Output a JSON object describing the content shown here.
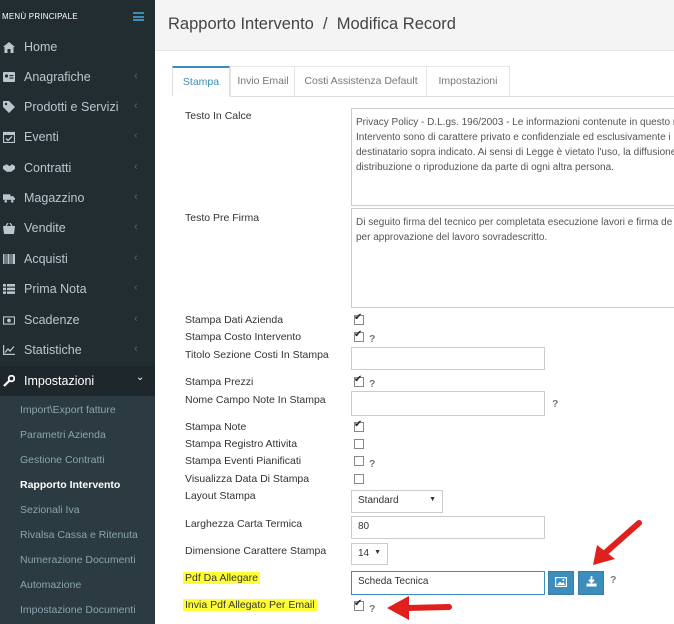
{
  "sidebar": {
    "header": "MENÙ PRINCIPALE",
    "items": [
      {
        "label": "Home",
        "icon": "home-icon"
      },
      {
        "label": "Anagrafiche",
        "icon": "id-card-icon"
      },
      {
        "label": "Prodotti e Servizi",
        "icon": "tag-icon"
      },
      {
        "label": "Eventi",
        "icon": "calendar-check-icon"
      },
      {
        "label": "Contratti",
        "icon": "handshake-icon"
      },
      {
        "label": "Magazzino",
        "icon": "truck-icon"
      },
      {
        "label": "Vendite",
        "icon": "basket-icon"
      },
      {
        "label": "Acquisti",
        "icon": "barcode-icon"
      },
      {
        "label": "Prima Nota",
        "icon": "list-icon"
      },
      {
        "label": "Scadenze",
        "icon": "money-icon"
      },
      {
        "label": "Statistiche",
        "icon": "chart-icon"
      },
      {
        "label": "Impostazioni",
        "icon": "wrench-icon"
      }
    ],
    "submenu": [
      "Import\\Export fatture",
      "Parametri Azienda",
      "Gestione Contratti",
      "Rapporto Intervento",
      "Sezionali Iva",
      "Rivalsa Cassa e Ritenuta",
      "Numerazione Documenti",
      "Automazione",
      "Impostazione Documenti"
    ]
  },
  "page": {
    "title": "Rapporto Intervento  /  Modifica Record"
  },
  "tabs": [
    "Stampa",
    "Invio Email",
    "Costi Assistenza Default",
    "Impostazioni"
  ],
  "form": {
    "testo_in_calce": {
      "label": "Testo In Calce",
      "lines": [
        "Privacy Policy - D.L.gs. 196/2003 - Le informazioni contenute in questo r",
        "Intervento sono di carattere privato e confidenziale ed esclusivamente i",
        "destinatario sopra indicato. Ai sensi di Legge è vietato l'uso, la diffusione",
        "distribuzione o riproduzione da parte di ogni altra persona."
      ]
    },
    "testo_pre_firma": {
      "label": "Testo Pre Firma",
      "lines": [
        "Di seguito firma del tecnico per completata esecuzione lavori e firma de",
        "per approvazione del lavoro sovradescritto."
      ]
    },
    "stampa_dati_azienda": {
      "label": "Stampa Dati Azienda",
      "checked": true
    },
    "stampa_costo_intervento": {
      "label": "Stampa Costo Intervento",
      "checked": true
    },
    "titolo_sezione_costi": {
      "label": "Titolo Sezione Costi In Stampa",
      "value": ""
    },
    "stampa_prezzi": {
      "label": "Stampa Prezzi",
      "checked": true
    },
    "nome_campo_note": {
      "label": "Nome Campo Note In Stampa",
      "value": ""
    },
    "stampa_note": {
      "label": "Stampa Note",
      "checked": true
    },
    "stampa_registro_attivita": {
      "label": "Stampa Registro Attivita",
      "checked": false
    },
    "stampa_eventi_pianificati": {
      "label": "Stampa Eventi Pianificati",
      "checked": false
    },
    "visualizza_data_di_stampa": {
      "label": "Visualizza Data Di Stampa",
      "checked": false
    },
    "layout_stampa": {
      "label": "Layout Stampa",
      "value": "Standard"
    },
    "larghezza_carta_termica": {
      "label": "Larghezza Carta Termica",
      "value": "80"
    },
    "dimensione_carattere": {
      "label": "Dimensione Carattere Stampa",
      "value": "14"
    },
    "pdf_da_allegare": {
      "label": "Pdf Da Allegare",
      "value": "Scheda Tecnica"
    },
    "invia_pdf_allegato": {
      "label": "Invia Pdf Allegato Per Email",
      "checked": true
    },
    "help_mark": "?"
  },
  "colors": {
    "sidebar_bg": "#222d32",
    "accent": "#3c8dbc",
    "highlight": "#ffff33",
    "annotation_arrow": "#e0201c"
  }
}
